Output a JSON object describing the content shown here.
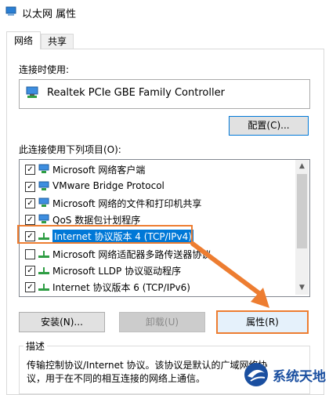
{
  "window": {
    "title": "以太网 属性"
  },
  "tabs": [
    {
      "label": "网络",
      "active": true
    },
    {
      "label": "共享",
      "active": false
    }
  ],
  "connect_using": {
    "label": "连接时使用:",
    "adapter": "Realtek PCIe GBE Family Controller",
    "configure_button": "配置(C)..."
  },
  "items_section": {
    "label": "此连接使用下列项目(O):",
    "items": [
      {
        "label": "Microsoft 网络客户端",
        "checked": true,
        "icon": "network-client-icon"
      },
      {
        "label": "VMware Bridge Protocol",
        "checked": true,
        "icon": "network-protocol-icon"
      },
      {
        "label": "Microsoft 网络的文件和打印机共享",
        "checked": true,
        "icon": "file-printer-sharing-icon"
      },
      {
        "label": "QoS 数据包计划程序",
        "checked": true,
        "icon": "network-protocol-icon"
      },
      {
        "label": "Internet 协议版本 4 (TCP/IPv4)",
        "checked": true,
        "selected": true,
        "icon": "protocol-icon"
      },
      {
        "label": "Microsoft 网络适配器多路传送器协议",
        "checked": false,
        "icon": "protocol-icon"
      },
      {
        "label": "Microsoft LLDP 协议驱动程序",
        "checked": true,
        "icon": "protocol-icon"
      },
      {
        "label": "Internet 协议版本 6 (TCP/IPv6)",
        "checked": true,
        "icon": "protocol-icon"
      }
    ]
  },
  "buttons": {
    "install": "安装(N)...",
    "uninstall": "卸载(U)",
    "properties": "属性(R)"
  },
  "description": {
    "label": "描述",
    "text": "传输控制协议/Internet 协议。该协议是默认的广域网络协议，用于在不同的相互连接的网络上通信。"
  },
  "watermark": {
    "text": "系统天地"
  },
  "colors": {
    "accent": "#0078d7",
    "highlight": "#ed7d31",
    "watermark": "#1a4fa0"
  }
}
